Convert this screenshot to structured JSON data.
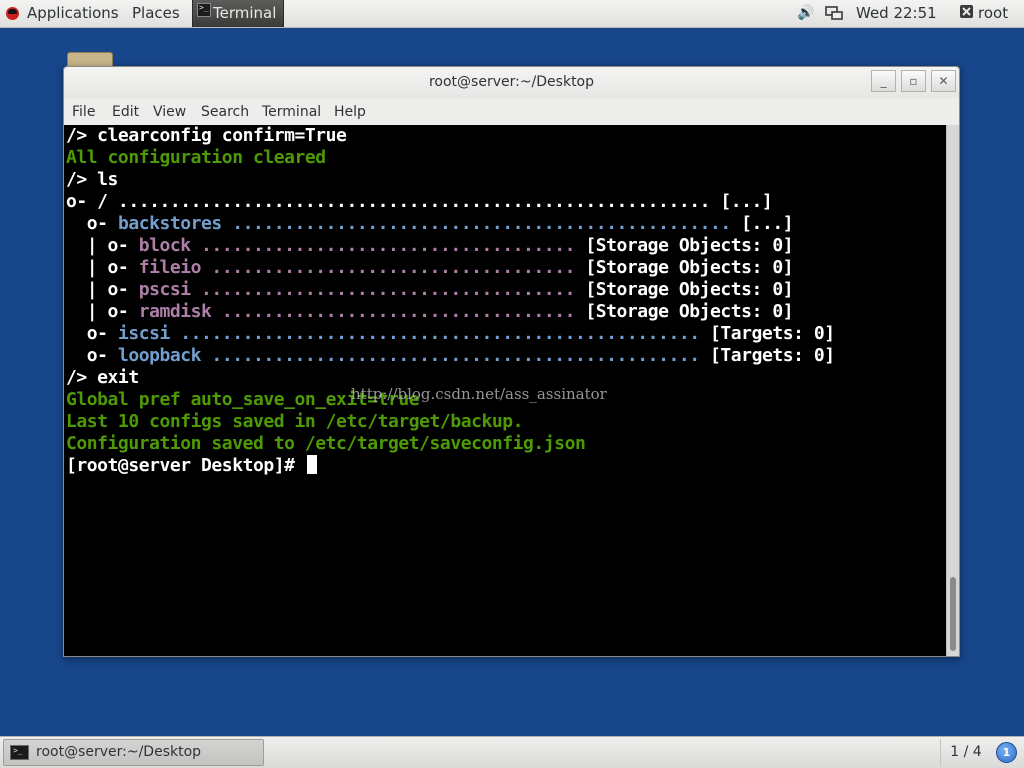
{
  "top_panel": {
    "applications": "Applications",
    "places": "Places",
    "task": "Terminal",
    "clock": "Wed 22:51",
    "user": "root",
    "icons": {
      "logo": "redhat-logo-icon",
      "volume": "volume-icon",
      "network": "network-icon",
      "user": "user-icon"
    }
  },
  "window": {
    "title": "root@server:~/Desktop",
    "menu": [
      "File",
      "Edit",
      "View",
      "Search",
      "Terminal",
      "Help"
    ],
    "buttons": {
      "minimize": "_",
      "maximize": "▫",
      "close": "✕"
    }
  },
  "terminal": {
    "lines": [
      [
        {
          "t": "/> clearconfig confirm=True",
          "c": "white"
        }
      ],
      [
        {
          "t": "All configuration cleared",
          "c": "green"
        }
      ],
      [
        {
          "t": "/> ls",
          "c": "white"
        }
      ],
      [
        {
          "t": "o- / ......................................................... [...]",
          "c": "white"
        }
      ],
      [
        {
          "t": "  o- ",
          "c": "white"
        },
        {
          "t": "backstores",
          "c": "blue"
        },
        {
          "t": " ................................................ ",
          "c": "blue"
        },
        {
          "t": "[...]",
          "c": "white"
        }
      ],
      [
        {
          "t": "  | o- ",
          "c": "white"
        },
        {
          "t": "block",
          "c": "purple"
        },
        {
          "t": " .................................... ",
          "c": "purple"
        },
        {
          "t": "[Storage Objects: 0]",
          "c": "white"
        }
      ],
      [
        {
          "t": "  | o- ",
          "c": "white"
        },
        {
          "t": "fileio",
          "c": "purple"
        },
        {
          "t": " ................................... ",
          "c": "purple"
        },
        {
          "t": "[Storage Objects: 0]",
          "c": "white"
        }
      ],
      [
        {
          "t": "  | o- ",
          "c": "white"
        },
        {
          "t": "pscsi",
          "c": "purple"
        },
        {
          "t": " .................................... ",
          "c": "purple"
        },
        {
          "t": "[Storage Objects: 0]",
          "c": "white"
        }
      ],
      [
        {
          "t": "  | o- ",
          "c": "white"
        },
        {
          "t": "ramdisk",
          "c": "purple"
        },
        {
          "t": " .................................. ",
          "c": "purple"
        },
        {
          "t": "[Storage Objects: 0]",
          "c": "white"
        }
      ],
      [
        {
          "t": "  o- ",
          "c": "white"
        },
        {
          "t": "iscsi",
          "c": "blue"
        },
        {
          "t": " .................................................. ",
          "c": "blue"
        },
        {
          "t": "[Targets: 0]",
          "c": "white"
        }
      ],
      [
        {
          "t": "  o- ",
          "c": "white"
        },
        {
          "t": "loopback",
          "c": "blue"
        },
        {
          "t": " ............................................... ",
          "c": "blue"
        },
        {
          "t": "[Targets: 0]",
          "c": "white"
        }
      ],
      [
        {
          "t": "/> exit",
          "c": "white"
        }
      ],
      [
        {
          "t": "Global pref auto_save_on_exit=true",
          "c": "green"
        }
      ],
      [
        {
          "t": "Last 10 configs saved in /etc/target/backup.",
          "c": "green"
        }
      ],
      [
        {
          "t": "Configuration saved to /etc/target/saveconfig.json",
          "c": "green"
        }
      ],
      [
        {
          "t": "[root@server Desktop]# ",
          "c": "white"
        }
      ]
    ],
    "watermark": "http://blog.csdn.net/ass_assinator",
    "colors": {
      "white": "#ffffff",
      "green": "#4e9a06",
      "blue": "#729fcf",
      "purple": "#ad7fa8",
      "background": "#000000"
    }
  },
  "bottom_panel": {
    "task": "root@server:~/Desktop",
    "workspace": "1 / 4",
    "notification_count": "1"
  },
  "desktop": {
    "background": "#17468a"
  }
}
